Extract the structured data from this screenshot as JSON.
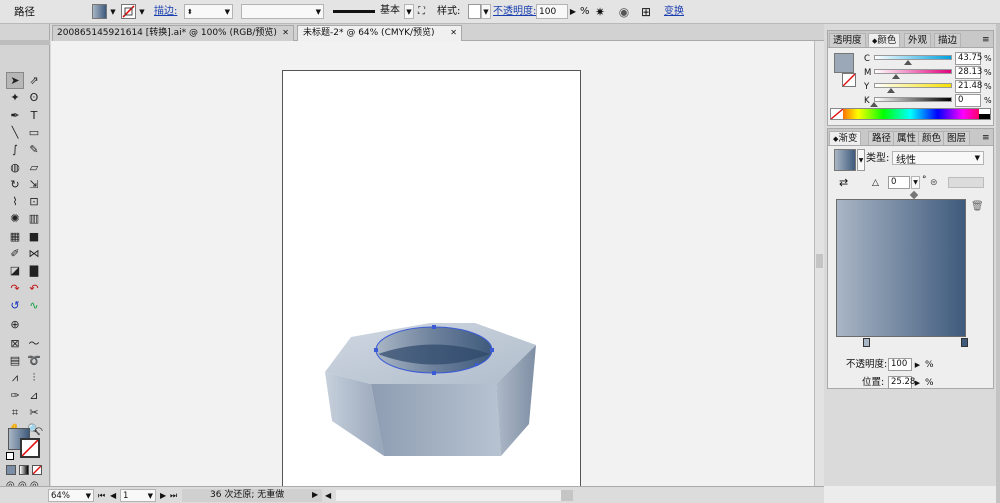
{
  "colors": {
    "ui_bg": "#dadada",
    "canvas": "#f2f2f2",
    "accent_blue": "#3c5a80",
    "nut_light": "#b9c5d4",
    "nut_dark": "#7d8da3",
    "gradient_start": "#a9b6c5",
    "gradient_end": "#3e5a7c"
  },
  "control_bar": {
    "object_type": "路径",
    "stroke_label": "描边:",
    "stroke_value": "",
    "weight_value": "",
    "brush_label": "基本",
    "style_label": "样式:",
    "opacity_label": "不透明度:",
    "opacity_value": "100",
    "opacity_unit": "%",
    "transform_label": "变换"
  },
  "doc_tabs": [
    {
      "label": "200865145921614 [转换].ai* @ 100% (RGB/预览)",
      "close": "✕"
    },
    {
      "label": "未标题-2* @ 64% (CMYK/预览)",
      "close": "✕"
    }
  ],
  "tools": {
    "icons": [
      "selection-icon",
      "direct-select-icon",
      "magic-wand-icon",
      "lasso-icon",
      "pen-icon",
      "type-icon",
      "line-icon",
      "rectangle-icon",
      "paintbrush-icon",
      "pencil-icon",
      "blob-brush-icon",
      "eraser-icon",
      "rotate-icon",
      "scale-icon",
      "warp-icon",
      "free-transform-icon",
      "symbol-sprayer-icon",
      "graph-icon",
      "mesh-icon",
      "gradient-tool-icon",
      "eyedropper-icon",
      "blend-icon",
      "live-paint-icon",
      "bar-graph-icon",
      "curve-red-icon",
      "curve-red2-icon",
      "curve-blue-icon",
      "curve-green-icon",
      "target-icon",
      "envelope-icon",
      "wave-icon",
      "column-icon",
      "twirl-icon",
      "zigzag-icon",
      "pipe-icon",
      "eyedropper2-icon",
      "measure-icon",
      "crop-icon",
      "knife-icon",
      "hand-icon",
      "zoom-icon"
    ]
  },
  "color_panel": {
    "tabs": [
      "透明度",
      "颜色",
      "外观",
      "描边"
    ],
    "active_tab": "颜色",
    "channels": [
      {
        "label": "C",
        "value": "43.75",
        "fraction": 0.4375,
        "grad_from": "#ffffff",
        "grad_to": "#00a0e0"
      },
      {
        "label": "M",
        "value": "28.13",
        "fraction": 0.2813,
        "grad_from": "#ffffff",
        "grad_to": "#e0007e"
      },
      {
        "label": "Y",
        "value": "21.48",
        "fraction": 0.2148,
        "grad_from": "#ffffff",
        "grad_to": "#f5e000"
      },
      {
        "label": "K",
        "value": "0",
        "fraction": 0.0,
        "grad_from": "#ffffff",
        "grad_to": "#000000"
      }
    ],
    "unit": "%",
    "swatch": "#9ba8b7"
  },
  "gradient_panel": {
    "tabs": [
      "渐变",
      "路径",
      "属性",
      "颜色",
      "图层"
    ],
    "active_tab": "渐变",
    "type_label": "类型:",
    "type_value": "线性",
    "angle_value": "0",
    "angle_unit": "°",
    "opacity_label": "不透明度:",
    "opacity_value": "100",
    "opacity_unit": "%",
    "location_label": "位置:",
    "location_value": "25.28",
    "location_unit": "%"
  },
  "status_bar": {
    "zoom": "64%",
    "page": "1",
    "history": "36 次还原; 无重做"
  }
}
